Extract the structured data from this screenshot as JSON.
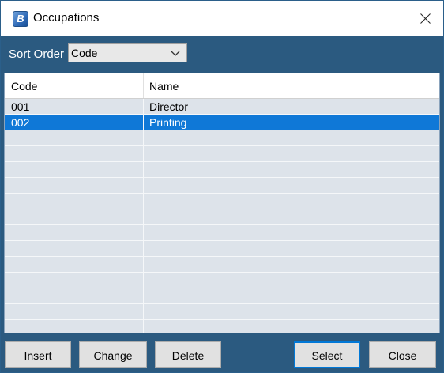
{
  "window": {
    "title": "Occupations",
    "icon": "app-logo-icon",
    "close_icon": "close-icon"
  },
  "sort": {
    "label": "Sort Order",
    "selected": "Code"
  },
  "table": {
    "columns": [
      "Code",
      "Name"
    ],
    "rows": [
      {
        "code": "001",
        "name": "Director",
        "selected": false
      },
      {
        "code": "002",
        "name": "Printing",
        "selected": true
      }
    ],
    "empty_rows": 13
  },
  "buttons": {
    "insert": "Insert",
    "change": "Change",
    "delete": "Delete",
    "select": "Select",
    "close": "Close"
  },
  "colors": {
    "panel_background": "#2b5a80",
    "row_background": "#dde3ea",
    "selected_row": "#0f78d7"
  }
}
